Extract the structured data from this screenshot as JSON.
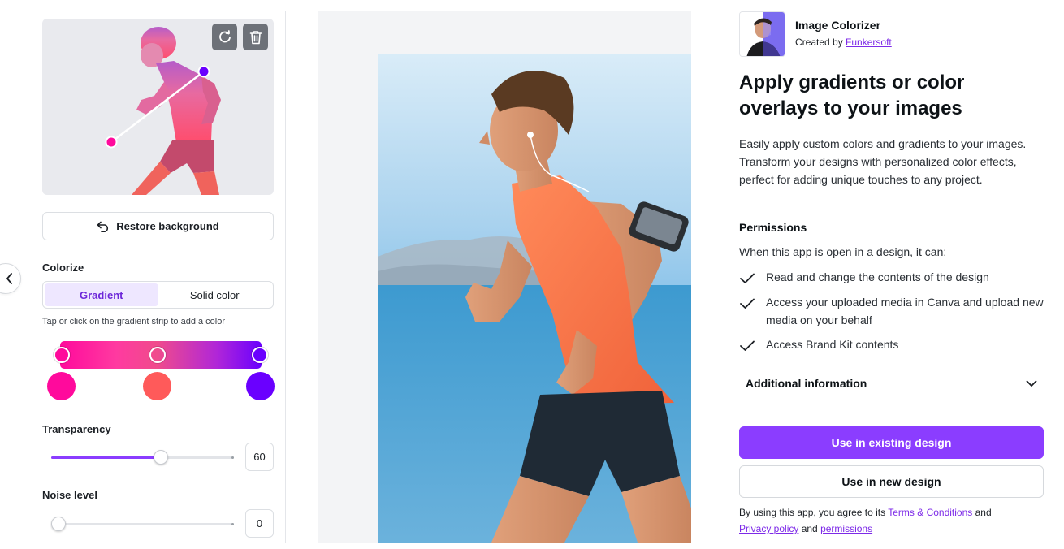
{
  "left_panel": {
    "restore_label": "Restore background",
    "colorize_label": "Colorize",
    "tabs": [
      {
        "label": "Gradient",
        "active": true
      },
      {
        "label": "Solid color",
        "active": false
      }
    ],
    "hint": "Tap or click on the gradient strip to add a color",
    "gradient_colors": [
      "#ff0a9c",
      "#ff5a5a",
      "#6a00ff"
    ],
    "transparency": {
      "label": "Transparency",
      "value": "60",
      "fraction": 0.6
    },
    "noise": {
      "label": "Noise level",
      "value": "0",
      "fraction": 0
    }
  },
  "app": {
    "name": "Image Colorizer",
    "created_by_prefix": "Created by ",
    "creator": "Funkersoft",
    "headline": "Apply gradients or color overlays to your images",
    "description": "Easily apply custom colors and gradients to your images. Transform your designs with personalized color effects, perfect for adding unique touches to any project.",
    "permissions_title": "Permissions",
    "permissions_intro": "When this app is open in a design, it can:",
    "permissions": [
      "Read and change the contents of the design",
      "Access your uploaded media in Canva and upload new media on your behalf",
      "Access Brand Kit contents"
    ],
    "additional_info": "Additional information",
    "primary_button": "Use in existing design",
    "secondary_button": "Use in new design",
    "terms": {
      "prefix": "By using this app, you agree to its ",
      "terms_link": "Terms & Conditions",
      "and1": " and ",
      "privacy_link": "Privacy policy",
      "and2": " and ",
      "permissions_link": "permissions"
    }
  },
  "colors": {
    "accent": "#8b3dff",
    "link": "#7d2ae8"
  }
}
